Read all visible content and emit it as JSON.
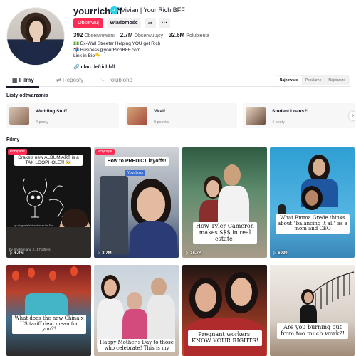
{
  "profile": {
    "username": "yourrichbff",
    "display_name": "Vivian | Your Rich BFF",
    "verified_icon": "verified-badge-icon",
    "follow_label": "Obserwuj",
    "message_label": "Wiadomość",
    "share_icon": "share-arrow-icon",
    "more_icon": "more-dots-icon",
    "stats": [
      {
        "value": "392",
        "label": "Obserwowani"
      },
      {
        "value": "2.7M",
        "label": "Obserwujący"
      },
      {
        "value": "32.6M",
        "label": "Polubienia"
      }
    ],
    "bio": [
      "💵 Ex-Wall Streeter Helping YOU get Rich",
      "📬 Business@yourRichBFF.com",
      "Link in Bio👇"
    ],
    "link": "clau.de/richbff"
  },
  "tabs": [
    {
      "label": "Filmy",
      "icon": "grid-icon"
    },
    {
      "label": "Reposty",
      "icon": "repost-icon"
    },
    {
      "label": "Polubiono",
      "icon": "heart-outline-icon"
    }
  ],
  "sort_options": [
    "Najnowsze",
    "Popularne",
    "Najstarsze"
  ],
  "playlists_title": "Listy odtwarzania",
  "playlists": [
    {
      "title": "Wedding Stuff",
      "count": "4 posty"
    },
    {
      "title": "Viral!",
      "count": "9 postów"
    },
    {
      "title": "Student Loans?!",
      "count": "4 posty"
    }
  ],
  "videos_title": "Filmy",
  "videos": [
    {
      "pinned": "Przypięte",
      "caption": "Drake's new ALBUM ART is a TAX LOOPHOLE?! 🤯",
      "small_text": "by using artists' donation as the For All the Dogs album art by Drizzy",
      "views": "6.9M",
      "bottom_meta": "by sky kam and 2,187 others"
    },
    {
      "pinned": "Przypięte",
      "caption": "How to PREDICT layoffs!",
      "sub": "Your boss",
      "views": "3.7M"
    },
    {
      "caption": "How Tyler Cameron makes $$$ in real estate!",
      "views": "16.7K"
    },
    {
      "caption": "What Emma Grede thinks about \"balancing it all\" as a mom and CEO",
      "views": "6939"
    },
    {
      "caption": "What does the new China x US tariff deal mean for you?!"
    },
    {
      "caption": "Happy Mother's Day to those who celebrate! This is my"
    },
    {
      "caption": "Pregnant workers: KNOW YOUR RIGHTS!"
    },
    {
      "caption": "Are you burning out from too much work?!"
    }
  ],
  "carousel_next_icon": "chevron-right-icon",
  "colors": {
    "accent": "#fe2c55",
    "verified": "#20d5ec"
  }
}
